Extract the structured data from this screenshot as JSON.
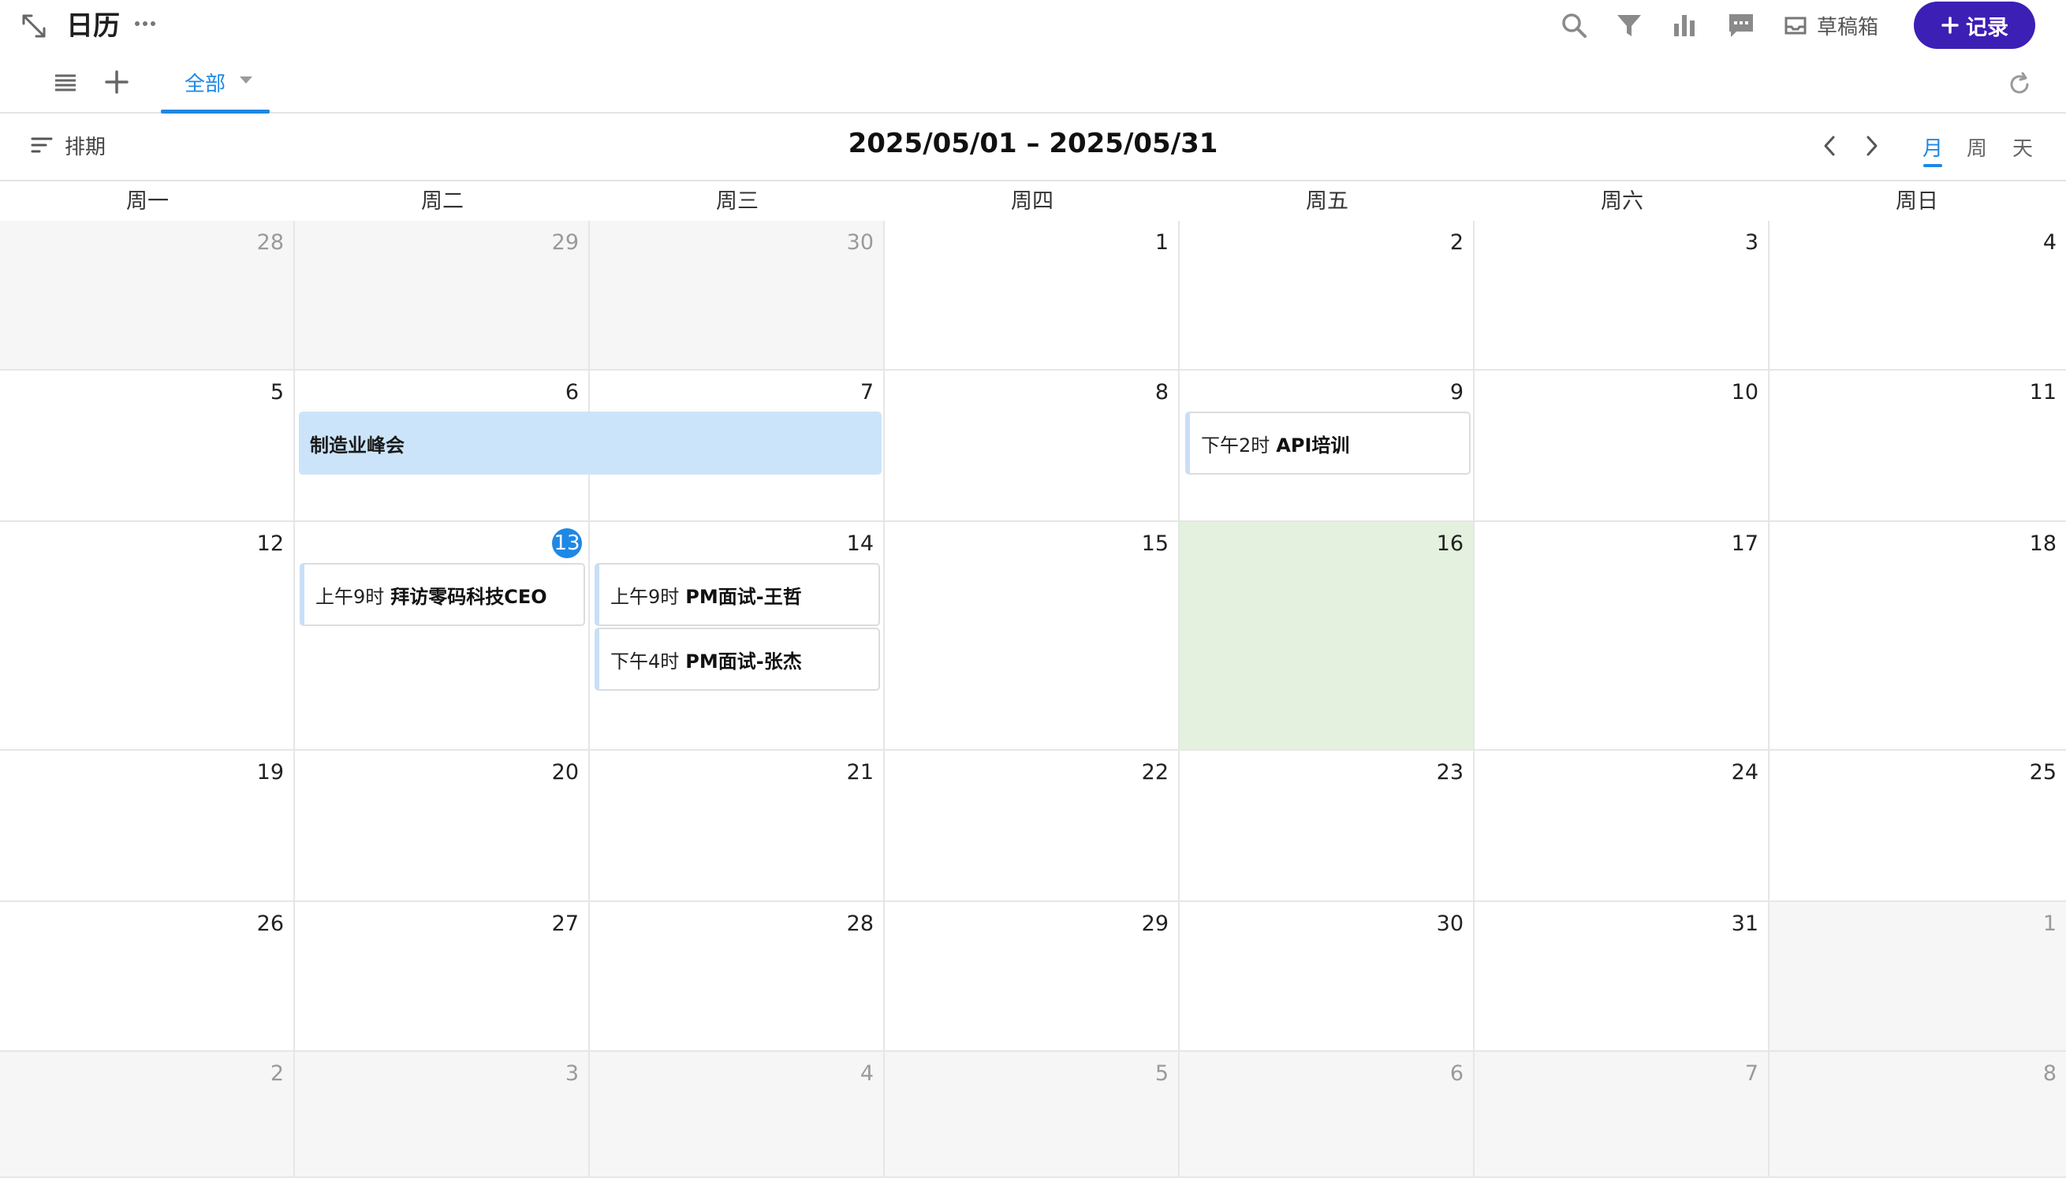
{
  "topbar": {
    "title": "日历",
    "drafts_label": "草稿箱",
    "record_label": "记录"
  },
  "views": {
    "active_tab": "全部"
  },
  "toolbar": {
    "schedule_label": "排期",
    "date_range": "2025/05/01 – 2025/05/31",
    "modes": [
      "月",
      "周",
      "天"
    ],
    "active_mode": "月"
  },
  "weekdays": [
    "周一",
    "周二",
    "周三",
    "周四",
    "周五",
    "周六",
    "周日"
  ],
  "weeks": [
    [
      "28",
      "29",
      "30",
      "1",
      "2",
      "3",
      "4"
    ],
    [
      "5",
      "6",
      "7",
      "8",
      "9",
      "10",
      "11"
    ],
    [
      "12",
      "13",
      "14",
      "15",
      "16",
      "17",
      "18"
    ],
    [
      "19",
      "20",
      "21",
      "22",
      "23",
      "24",
      "25"
    ],
    [
      "26",
      "27",
      "28",
      "29",
      "30",
      "31",
      "1"
    ],
    [
      "2",
      "3",
      "4",
      "5",
      "6",
      "7",
      "8"
    ]
  ],
  "today": "13",
  "highlighted_day": "16",
  "events": {
    "summit": {
      "title": "制造业峰会"
    },
    "api_training": {
      "time": "下午2时",
      "title": "API培训"
    },
    "visit_ceo": {
      "time": "上午9时",
      "title": "拜访零码科技CEO"
    },
    "interview_wang": {
      "time": "上午9时",
      "title": "PM面试-王哲"
    },
    "interview_zhang": {
      "time": "下午4时",
      "title": "PM面试-张杰"
    }
  },
  "colors": {
    "accent": "#1e88e5",
    "record_button": "#3c1fb5",
    "highlight_day": "#e3f1de",
    "event_bar": "#cce4f9"
  }
}
